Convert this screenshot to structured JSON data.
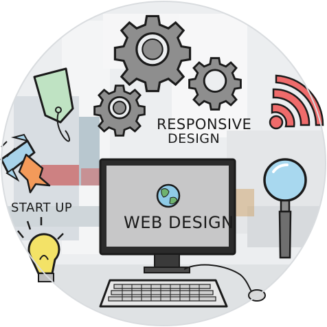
{
  "labels": {
    "responsive_line1": "RESPONSIVE",
    "responsive_line2": "DESIGN",
    "start_up": "START UP",
    "web_design": "WEB DESIGN"
  },
  "icons": [
    "gear-icon",
    "price-tag-icon",
    "rocket-icon",
    "wifi-icon",
    "magnifying-glass-icon",
    "globe-icon",
    "lightbulb-icon",
    "desktop-monitor-icon",
    "keyboard-icon",
    "mouse-icon"
  ],
  "colors": {
    "circle_bg": "#e9ecef",
    "gear": "#8e8e8e",
    "tag": "#bfe3c3",
    "wifi": "#ef6b6b",
    "lens": "#a8d8ef",
    "rocket_flame": "#f39a5a",
    "bulb": "#f3e267",
    "ink": "#1a1a1a"
  }
}
